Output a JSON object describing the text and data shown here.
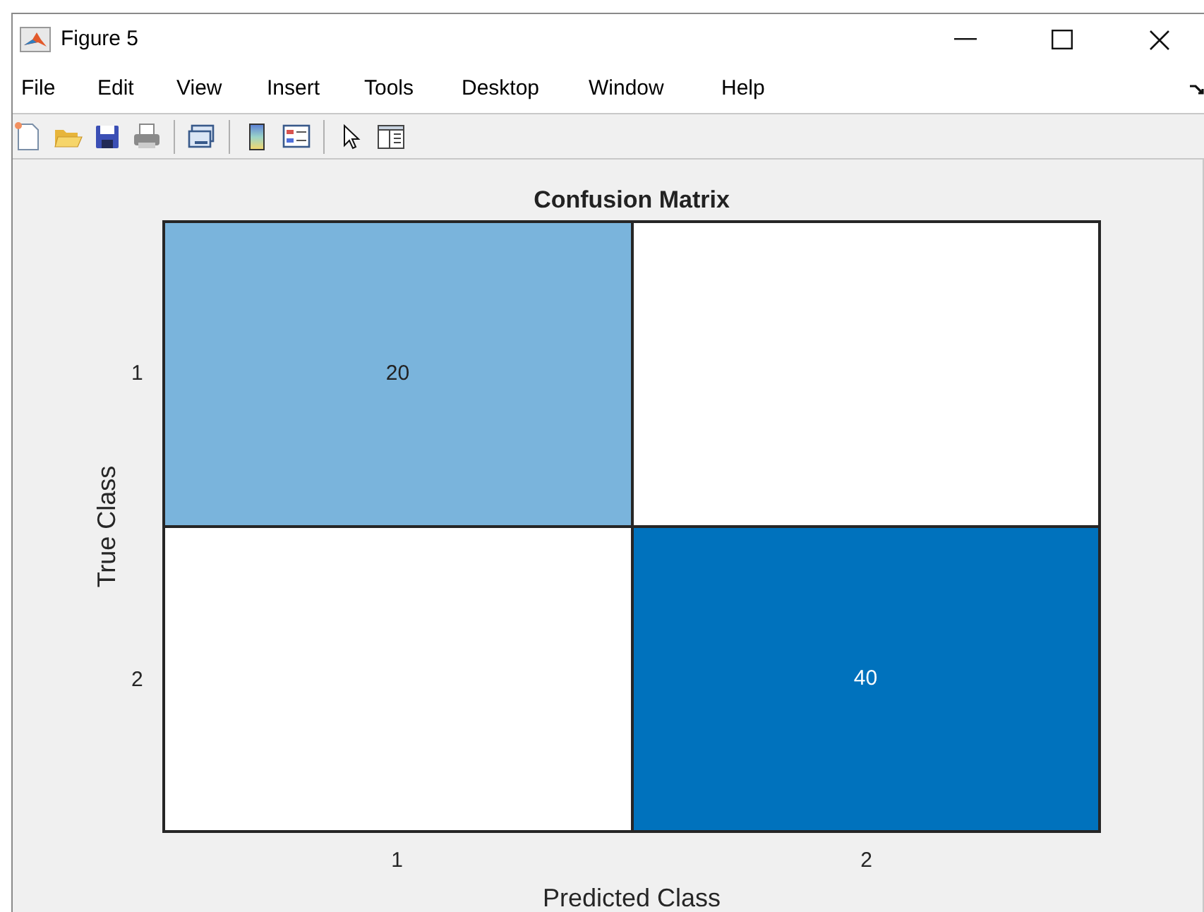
{
  "window": {
    "title": "Figure 5"
  },
  "menu": [
    "File",
    "Edit",
    "View",
    "Insert",
    "Tools",
    "Desktop",
    "Window",
    "Help"
  ],
  "matrix": {
    "title": "Confusion Matrix",
    "ylabel": "True Class",
    "xlabel": "Predicted Class",
    "row_labels": [
      "1",
      "2"
    ],
    "column_labels": [
      "1",
      "2"
    ],
    "rows": [
      {
        "cells": [
          {
            "value": "20",
            "color": "#7ab4dc"
          },
          {
            "color": "#ffffff"
          }
        ]
      },
      {
        "cells": [
          {
            "color": "#ffffff"
          },
          {
            "value": "40",
            "color": "#0072bd"
          }
        ]
      }
    ]
  }
}
